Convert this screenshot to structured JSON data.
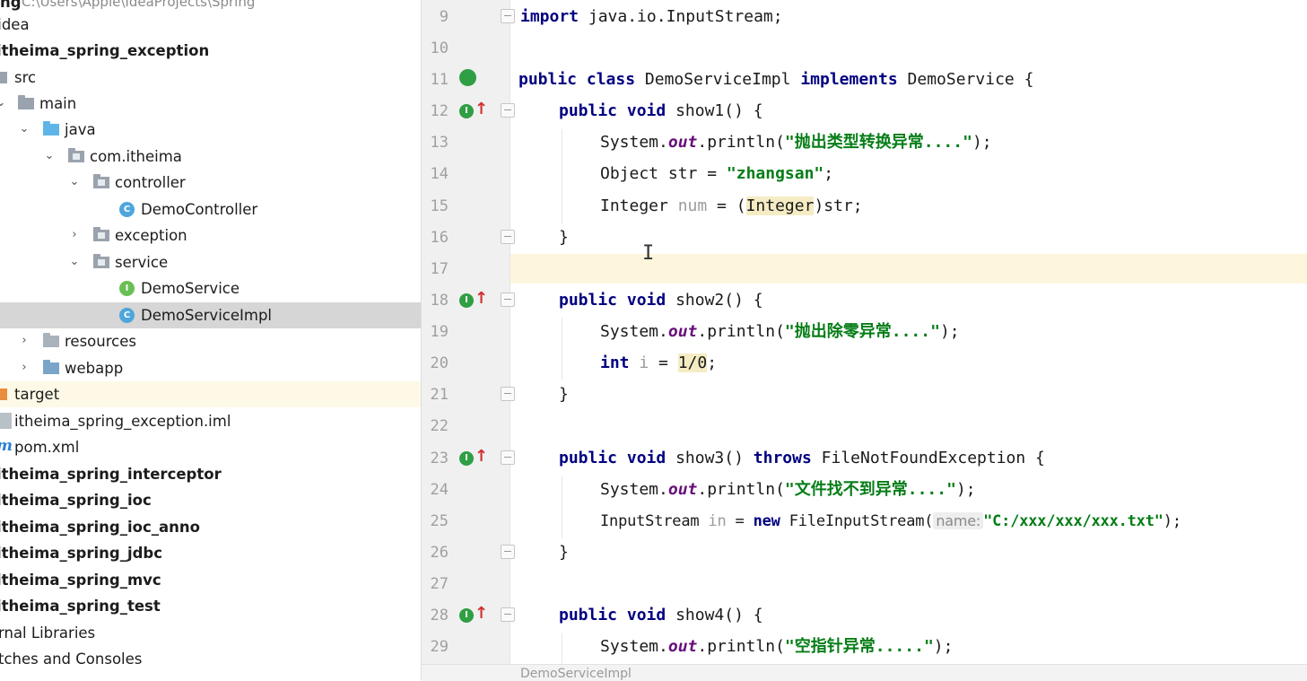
{
  "tree": {
    "path_row": {
      "bold": "ng",
      "path": "C:\\Users\\Apple\\IdeaProjects\\Spring"
    },
    "idea": ".idea",
    "module": "itheima_spring_exception",
    "src": "src",
    "main": "main",
    "java": "java",
    "package": "com.itheima",
    "controller": "controller",
    "demo_controller": "DemoController",
    "exception": "exception",
    "service": "service",
    "demo_service": "DemoService",
    "demo_service_impl": "DemoServiceImpl",
    "resources": "resources",
    "webapp": "webapp",
    "target": "target",
    "iml": "itheima_spring_exception.iml",
    "pom_icon": "m",
    "pom": "pom.xml",
    "other_modules": [
      "itheima_spring_interceptor",
      "itheima_spring_ioc",
      "itheima_spring_ioc_anno",
      "itheima_spring_jdbc",
      "itheima_spring_mvc",
      "itheima_spring_test"
    ],
    "external_libraries": "rnal Libraries",
    "scratches": "tches and Consoles",
    "icon_class": "C",
    "icon_interface": "I"
  },
  "editor": {
    "line_numbers": [
      "9",
      "10",
      "11",
      "12",
      "13",
      "14",
      "15",
      "16",
      "17",
      "18",
      "19",
      "20",
      "21",
      "22",
      "23",
      "24",
      "25",
      "26",
      "27",
      "28",
      "29"
    ],
    "l9": {
      "kw": "import",
      "rest": " java.io.InputStream;"
    },
    "l11": {
      "kw1": "public",
      "kw2": "class",
      "name": "DemoServiceImpl",
      "kw3": "implements",
      "iface": "DemoService",
      "brace": "{"
    },
    "l12": {
      "kw1": "public",
      "kw2": "void",
      "sig": "show1() {"
    },
    "l13": {
      "pre": "System.",
      "fld": "out",
      "mid": ".println(",
      "str": "\"抛出类型转换异常....\"",
      "end": ");"
    },
    "l14": {
      "pre": "Object str = ",
      "str": "\"zhangsan\"",
      "end": ";"
    },
    "l15": {
      "pre": "Integer ",
      "var": "num",
      "mid": " = (",
      "cast": "Integer",
      "end": ")str;"
    },
    "close_brace": "}",
    "l18": {
      "kw1": "public",
      "kw2": "void",
      "sig": "show2() {"
    },
    "l19": {
      "pre": "System.",
      "fld": "out",
      "mid": ".println(",
      "str": "\"抛出除零异常....\"",
      "end": ");"
    },
    "l20": {
      "kw": "int",
      "var": "i",
      "mid": " = ",
      "expr": "1/0",
      "end": ";"
    },
    "l23": {
      "kw1": "public",
      "kw2": "void",
      "sig": "show3() ",
      "kw3": "throws",
      "rest": " FileNotFoundException {"
    },
    "l24": {
      "pre": "System.",
      "fld": "out",
      "mid": ".println(",
      "str": "\"文件找不到异常....\"",
      "end": ");"
    },
    "l25": {
      "pre": "InputStream ",
      "var": "in",
      "mid": " = ",
      "kw": "new",
      "call": " FileInputStream(",
      "hint": "name:",
      "str": "\"C:/xxx/xxx/xxx.txt\"",
      "end": ");"
    },
    "l28": {
      "kw1": "public",
      "kw2": "void",
      "sig": "show4() {"
    },
    "l29": {
      "pre": "System.",
      "fld": "out",
      "mid": ".println(",
      "str": "\"空指针异常.....\"",
      "end": ");"
    },
    "caret_glyph": "I",
    "status_label": "DemoServiceImpl"
  }
}
